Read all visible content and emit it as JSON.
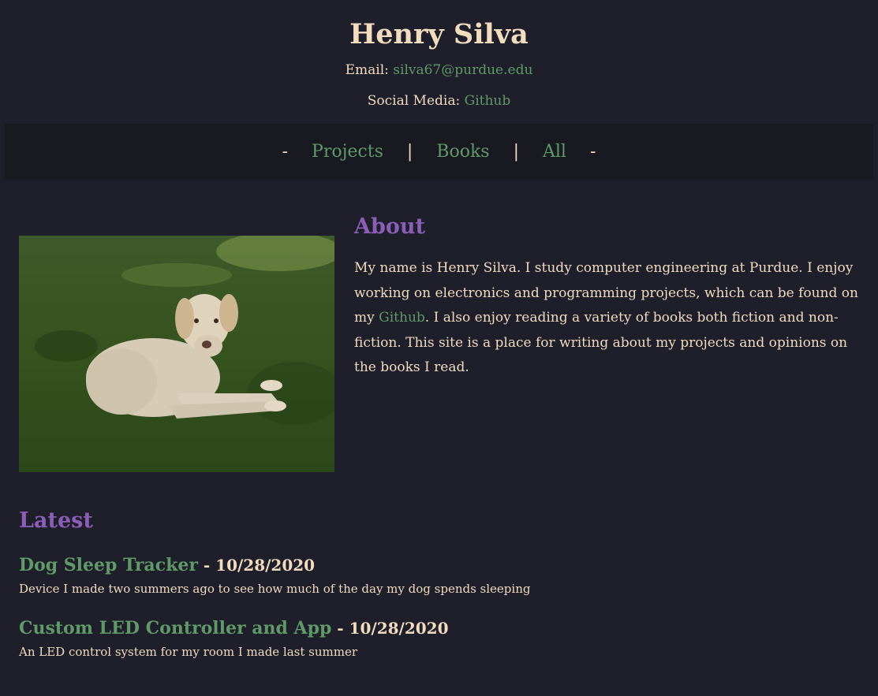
{
  "header": {
    "name": "Henry Silva",
    "email_label": "Email:",
    "email": "silva67@purdue.edu",
    "social_label": "Social Media:",
    "social_link": "Github"
  },
  "nav": {
    "dash_left": "-",
    "items": [
      "Projects",
      "Books",
      "All"
    ],
    "sep": "|",
    "dash_right": "-"
  },
  "about": {
    "heading": "About",
    "text_before": "My name is Henry Silva. I study computer engineering at Purdue. I enjoy working on electronics and programming projects, which can be found on my ",
    "link": "Github",
    "text_after": ". I also enjoy reading a variety of books both fiction and non-fiction. This site is a place for writing about my projects and opinions on the books I read.",
    "photo_icon": "dog-photo"
  },
  "latest": {
    "heading": "Latest",
    "posts": [
      {
        "title": "Dog Sleep Tracker",
        "date": " - 10/28/2020",
        "desc": "Device I made two summers ago to see how much of the day my dog spends sleeping"
      },
      {
        "title": "Custom LED Controller and App",
        "date": " - 10/28/2020",
        "desc": "An LED control system for my room I made last summer"
      }
    ]
  },
  "colors": {
    "background": "#1f1e2b",
    "nav_background": "#191921",
    "text": "#f1dcbf",
    "link": "#5f9a68",
    "heading": "#8b5fb5"
  }
}
